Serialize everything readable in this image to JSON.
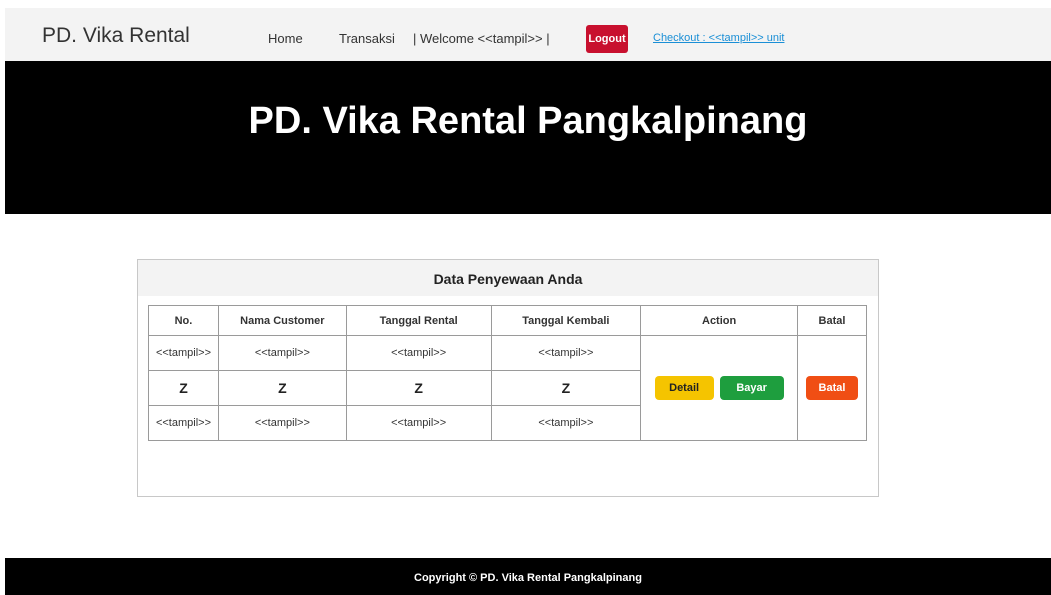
{
  "navbar": {
    "brand": "PD. Vika Rental",
    "home": "Home",
    "transaksi": "Transaksi",
    "welcome": "| Welcome <<tampil>> |",
    "logout": "Logout",
    "checkout": "Checkout : <<tampil>>  unit"
  },
  "hero": {
    "title": "PD. Vika Rental Pangkalpinang"
  },
  "panel": {
    "heading": "Data Penyewaan Anda",
    "columns": [
      "No.",
      "Nama Customer",
      "Tanggal Rental",
      "Tanggal Kembali",
      "Action",
      "Batal"
    ],
    "rows": [
      [
        "<<tampil>>",
        "<<tampil>>",
        "<<tampil>>",
        "<<tampil>>"
      ],
      [
        "Z",
        "Z",
        "Z",
        "Z"
      ],
      [
        "<<tampil>>",
        "<<tampil>>",
        "<<tampil>>",
        "<<tampil>>"
      ]
    ],
    "actions": {
      "detail": "Detail",
      "bayar": "Bayar",
      "batal": "Batal"
    }
  },
  "footer": {
    "copyright": "Copyright © PD. Vika Rental Pangkalpinang"
  },
  "colors": {
    "logout": "#c8102e",
    "detail": "#f5c400",
    "bayar": "#1e9e3e",
    "batal": "#f04e14",
    "link": "#1a8fd6"
  }
}
